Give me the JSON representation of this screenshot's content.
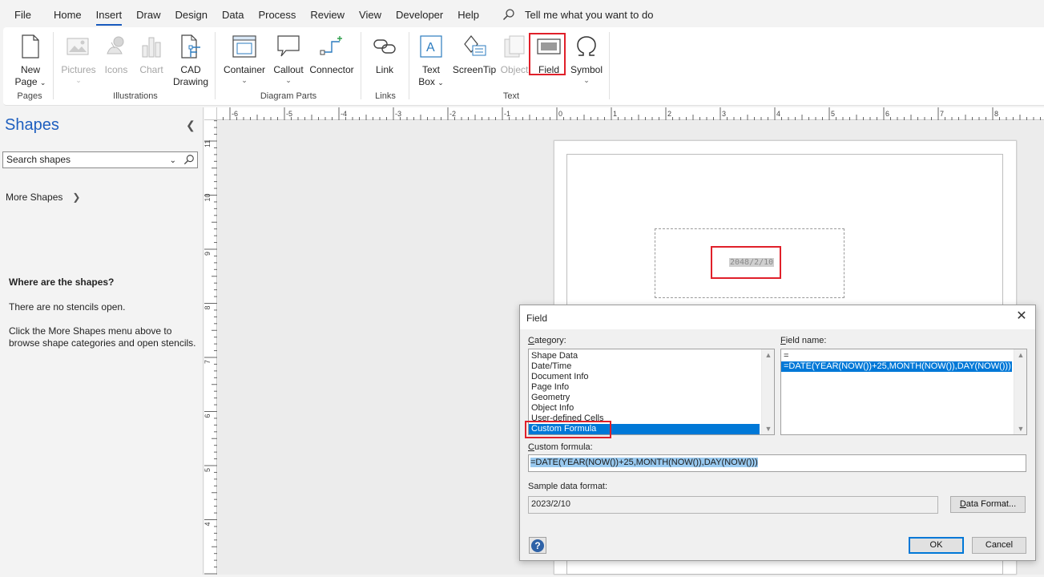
{
  "menu": {
    "items": [
      "File",
      "Home",
      "Insert",
      "Draw",
      "Design",
      "Data",
      "Process",
      "Review",
      "View",
      "Developer",
      "Help"
    ],
    "active": "Insert",
    "tell_me": "Tell me what you want to do"
  },
  "ribbon": {
    "new_page": {
      "label1": "New",
      "label2": "Page"
    },
    "pictures": "Pictures",
    "icons": "Icons",
    "chart": "Chart",
    "cad": {
      "label1": "CAD",
      "label2": "Drawing"
    },
    "container": "Container",
    "callout": "Callout",
    "connector": "Connector",
    "link": "Link",
    "textbox": {
      "label1": "Text",
      "label2": "Box"
    },
    "screentip": "ScreenTip",
    "object": "Object",
    "field": "Field",
    "symbol": "Symbol",
    "groups": {
      "pages": "Pages",
      "illustrations": "Illustrations",
      "diagram_parts": "Diagram Parts",
      "links": "Links",
      "text": "Text"
    }
  },
  "shapes_pane": {
    "title": "Shapes",
    "search_placeholder": "Search shapes",
    "more_shapes": "More Shapes",
    "where_heading": "Where are the shapes?",
    "no_stencils": "There are no stencils open.",
    "instructions": "Click the More Shapes menu above to browse shape categories and open stencils."
  },
  "rulers": {
    "top": [
      "-6",
      "-5",
      "-4",
      "-3",
      "-2",
      "-1",
      "0",
      "1",
      "2",
      "3",
      "4",
      "5",
      "6",
      "7",
      "8"
    ],
    "left": [
      "11",
      "10",
      "9",
      "8",
      "7",
      "6",
      "5",
      "4"
    ]
  },
  "canvas": {
    "field_value": "2048/2/10"
  },
  "dialog": {
    "title": "Field",
    "category_label": "Category:",
    "categories": [
      "Shape Data",
      "Date/Time",
      "Document Info",
      "Page Info",
      "Geometry",
      "Object Info",
      "User-defined Cells",
      "Custom Formula"
    ],
    "selected_category": "Custom Formula",
    "field_name_label": "Field name:",
    "field_names": [
      "=",
      "=DATE(YEAR(NOW())+25,MONTH(NOW()),DAY(NOW()))"
    ],
    "selected_field_name": "=DATE(YEAR(NOW())+25,MONTH(NOW()),DAY(NOW()))",
    "custom_formula_label": "Custom formula:",
    "custom_formula_value": "=DATE(YEAR(NOW())+25,MONTH(NOW()),DAY(NOW()))",
    "sample_format_label": "Sample data format:",
    "sample_format_value": "2023/2/10",
    "data_format_button": "Data Format...",
    "ok_button": "OK",
    "cancel_button": "Cancel"
  },
  "colors": {
    "accent": "#185abd",
    "selection": "#0078d7",
    "highlight_box": "#e0202a"
  }
}
